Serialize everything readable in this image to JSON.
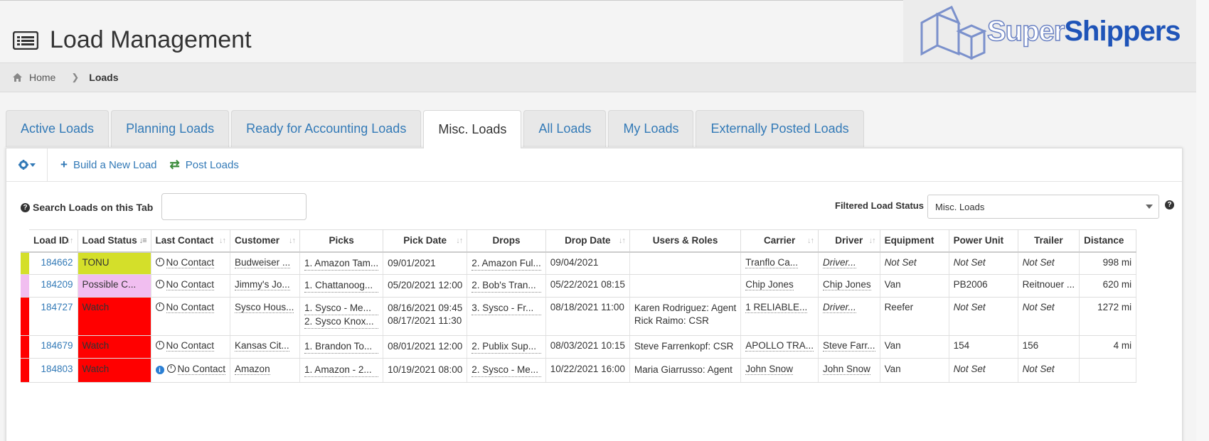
{
  "header": {
    "title": "Load Management"
  },
  "logo": {
    "super": "Super",
    "shippers": "Shippers"
  },
  "breadcrumb": {
    "home": "Home",
    "current": "Loads"
  },
  "tabs": [
    {
      "label": "Active Loads"
    },
    {
      "label": "Planning Loads"
    },
    {
      "label": "Ready for Accounting Loads"
    },
    {
      "label": "Misc. Loads",
      "active": true
    },
    {
      "label": "All Loads"
    },
    {
      "label": "My Loads"
    },
    {
      "label": "Externally Posted Loads"
    }
  ],
  "toolbar": {
    "build_label": "Build a New Load",
    "post_label": "Post Loads"
  },
  "search": {
    "label": "Search Loads on this Tab",
    "value": ""
  },
  "filter": {
    "label": "Filtered Load Status",
    "selected": "Misc. Loads"
  },
  "table": {
    "columns": [
      "Load ID",
      "Load Status",
      "Last Contact",
      "Customer",
      "Picks",
      "Pick Date",
      "Drops",
      "Drop Date",
      "Users & Roles",
      "Carrier",
      "Driver",
      "Equipment",
      "Power Unit",
      "Trailer",
      "Distance"
    ],
    "rows": [
      {
        "status_color": "#d4df2a",
        "id": "184662",
        "status": "TONU",
        "last_contact": "No Contact",
        "customer": "Budweiser ...",
        "picks": [
          "1. Amazon Tam..."
        ],
        "pick_dates": [
          "09/01/2021"
        ],
        "drops": [
          "2. Amazon Ful..."
        ],
        "drop_date": "09/04/2021",
        "users": [],
        "carrier": "Tranflo Ca...",
        "driver": "Driver...",
        "equipment": "Not Set",
        "power_unit": "Not Set",
        "trailer": "Not Set",
        "distance": "998 mi"
      },
      {
        "status_color": "#f1bef0",
        "id": "184209",
        "status": "Possible C...",
        "last_contact": "No Contact",
        "customer": "Jimmy's Jo...",
        "picks": [
          "1. Chattanoog..."
        ],
        "pick_dates": [
          "05/20/2021 12:00"
        ],
        "drops": [
          "2. Bob's Tran..."
        ],
        "drop_date": "05/22/2021 08:15",
        "users": [],
        "carrier": "Chip Jones",
        "driver": "Chip Jones",
        "equipment": "Van",
        "power_unit": "PB2006",
        "trailer": "Reitnouer ...",
        "distance": "620 mi"
      },
      {
        "status_color": "#ff0000",
        "id": "184727",
        "status": "Watch",
        "last_contact": "No Contact",
        "customer": "Sysco Hous...",
        "picks": [
          "1. Sysco - Me...",
          "2. Sysco Knox..."
        ],
        "pick_dates": [
          "08/16/2021 09:45",
          "08/17/2021 11:30"
        ],
        "drops": [
          "3. Sysco - Fr..."
        ],
        "drop_date": "08/18/2021 11:00",
        "users": [
          "Karen Rodriguez: Agent",
          "Rick Raimo: CSR"
        ],
        "carrier": "1 RELIABLE...",
        "driver": "Driver...",
        "equipment": "Reefer",
        "power_unit": "Not Set",
        "trailer": "Not Set",
        "distance": "1272 mi"
      },
      {
        "status_color": "#ff0000",
        "id": "184679",
        "status": "Watch",
        "last_contact": "No Contact",
        "customer": "Kansas Cit...",
        "picks": [
          "1. Brandon To..."
        ],
        "pick_dates": [
          "08/01/2021 12:00"
        ],
        "drops": [
          "2. Publix Sup..."
        ],
        "drop_date": "08/03/2021 10:15",
        "users": [
          "Steve Farrenkopf: CSR"
        ],
        "carrier": "APOLLO TRA...",
        "driver": "Steve Farr...",
        "equipment": "Van",
        "power_unit": "154",
        "trailer": "156",
        "distance": "4 mi"
      },
      {
        "status_color": "#ff0000",
        "id": "184803",
        "status": "Watch",
        "last_contact": "No Contact",
        "has_info": true,
        "customer": "Amazon",
        "picks": [
          "1. Amazon - 2..."
        ],
        "pick_dates": [
          "10/19/2021 08:00"
        ],
        "drops": [
          "2. Sysco - Me..."
        ],
        "drop_date": "10/22/2021 16:00",
        "users": [
          "Maria Giarrusso: Agent"
        ],
        "carrier": "John Snow",
        "driver": "John Snow",
        "equipment": "Van",
        "power_unit": "Not Set",
        "trailer": "Not Set",
        "distance": ""
      }
    ]
  }
}
